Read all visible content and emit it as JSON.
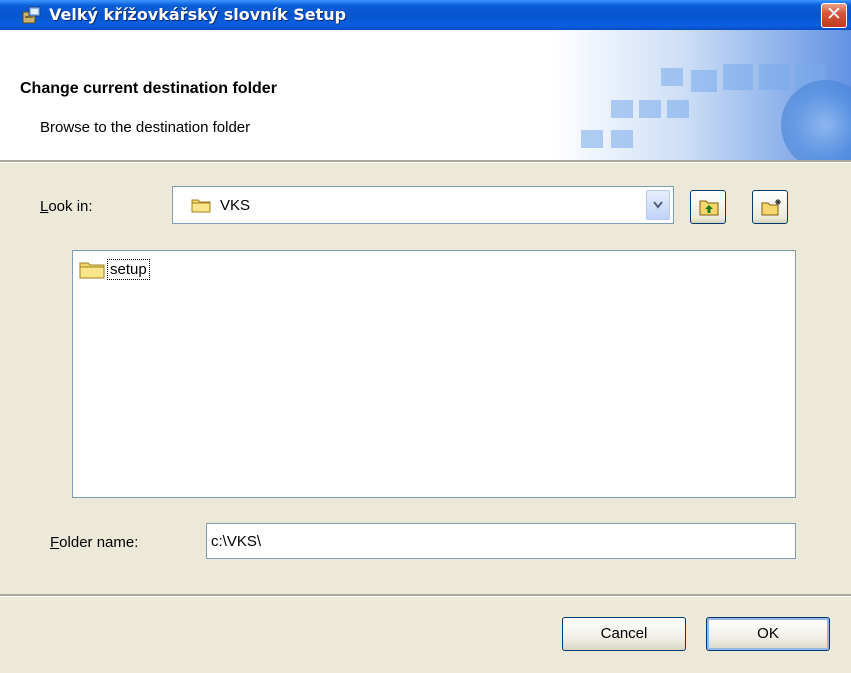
{
  "window": {
    "title": "Velký křížovkářský slovník Setup",
    "close_label": "✕"
  },
  "header": {
    "title": "Change current destination folder",
    "subtitle": "Browse to the destination folder"
  },
  "look_in": {
    "label_accel": "L",
    "label_rest": "ook in:",
    "value": "VKS"
  },
  "folders": [
    {
      "name": "setup"
    }
  ],
  "folder_name": {
    "label_accel": "F",
    "label_rest": "older name:",
    "value": "c:\\VKS\\"
  },
  "buttons": {
    "cancel": "Cancel",
    "ok": "OK"
  },
  "colors": {
    "titlebar": "#0854d0",
    "dialog_bg": "#ece9d8",
    "close_button": "#d6553a"
  }
}
